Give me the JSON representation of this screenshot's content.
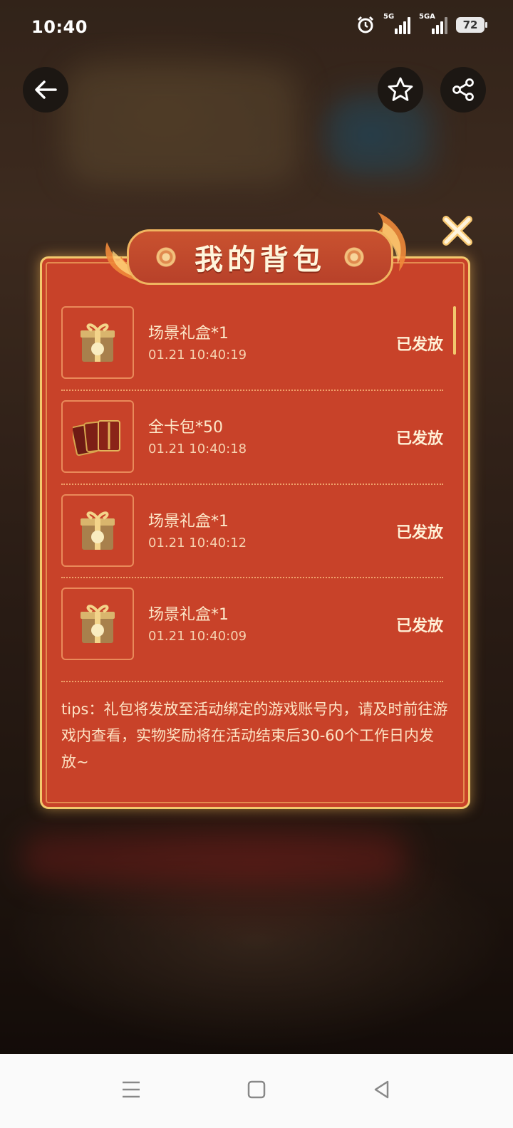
{
  "status_bar": {
    "time": "10:40",
    "signal1_label": "5G",
    "signal2_label": "5GA",
    "battery": "72"
  },
  "top_actions": {
    "back_icon": "arrow-left-icon",
    "favorite_icon": "star-icon",
    "share_icon": "share-icon"
  },
  "modal": {
    "title": "我的背包",
    "items": [
      {
        "name": "场景礼盒*1",
        "time": "01.21 10:40:19",
        "status": "已发放",
        "icon": "gift-box-icon"
      },
      {
        "name": "全卡包*50",
        "time": "01.21 10:40:18",
        "status": "已发放",
        "icon": "card-pack-icon"
      },
      {
        "name": "场景礼盒*1",
        "time": "01.21 10:40:12",
        "status": "已发放",
        "icon": "gift-box-icon"
      },
      {
        "name": "场景礼盒*1",
        "time": "01.21 10:40:09",
        "status": "已发放",
        "icon": "gift-box-icon"
      }
    ],
    "tips": "tips：礼包将发放至活动绑定的游戏账号内，请及时前往游戏内查看，实物奖励将在活动结束后30-60个工作日内发放~"
  },
  "nav_bar": {
    "menu_icon": "menu-icon",
    "home_icon": "home-square-icon",
    "back_icon": "triangle-back-icon"
  },
  "colors": {
    "modal_bg": "#c84229",
    "border_gold": "#f2c86d",
    "text_light": "#fde7c8"
  }
}
